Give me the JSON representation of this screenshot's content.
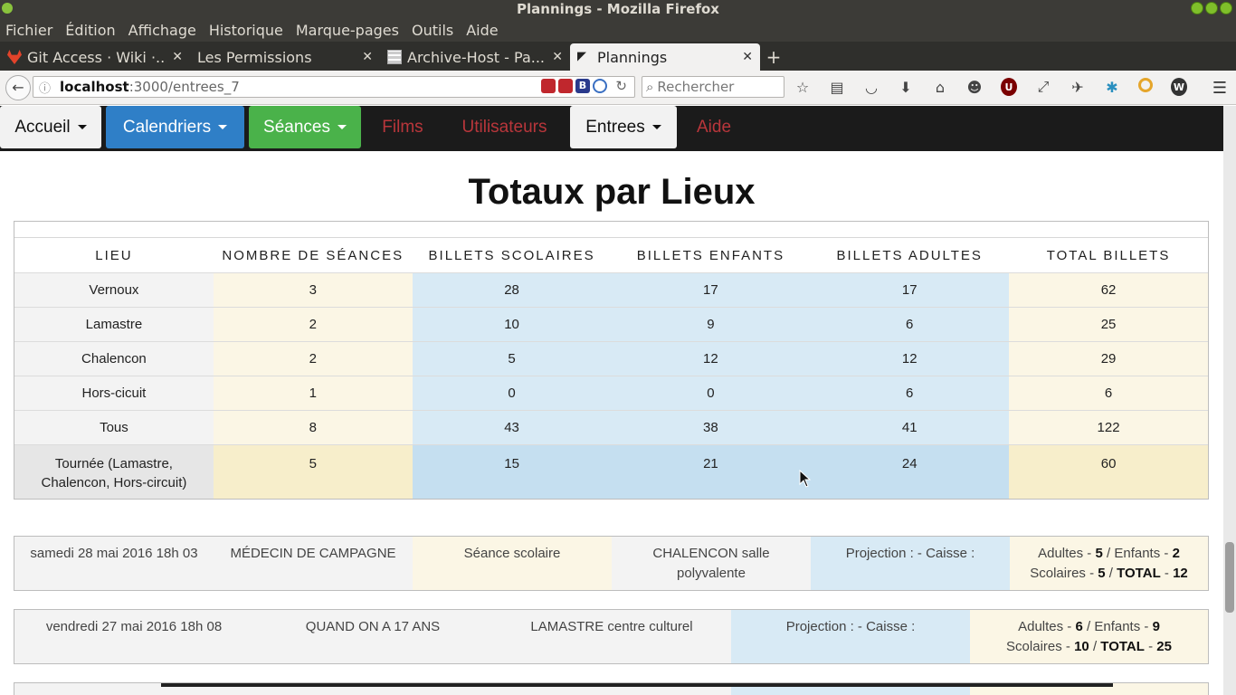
{
  "window": {
    "title": "Plannings - Mozilla Firefox"
  },
  "menubar": [
    "Fichier",
    "Édition",
    "Affichage",
    "Historique",
    "Marque-pages",
    "Outils",
    "Aide"
  ],
  "tabs": [
    {
      "label": "Git Access · Wiki ·...",
      "icon": "gitlab-icon",
      "active": false
    },
    {
      "label": "Les Permissions",
      "icon": "",
      "active": false
    },
    {
      "label": "Archive-Host - Pa...",
      "icon": "grid-icon",
      "active": false
    },
    {
      "label": "Plannings",
      "icon": "page-icon",
      "active": true
    }
  ],
  "urlbar": {
    "host": "localhost",
    "path": ":3000/entrees_7"
  },
  "search": {
    "placeholder": "Rechercher"
  },
  "sitenav": {
    "accueil": "Accueil",
    "calendriers": "Calendriers",
    "seances": "Séances",
    "films": "Films",
    "utilisateurs": "Utilisateurs",
    "entrees": "Entrees",
    "aide": "Aide"
  },
  "colors": {
    "blue": "#2f7fc7",
    "green": "#4ab24a",
    "red_text": "#b9363b",
    "dark_nav": "#1b1b1b"
  },
  "page_title": "Totaux par Lieux",
  "totals": {
    "headers": [
      "LIEU",
      "NOMBRE DE SÉANCES",
      "BILLETS SCOLAIRES",
      "BILLETS ENFANTS",
      "BILLETS ADULTES",
      "TOTAL BILLETS"
    ],
    "rows": [
      [
        "Vernoux",
        "3",
        "28",
        "17",
        "17",
        "62"
      ],
      [
        "Lamastre",
        "2",
        "10",
        "9",
        "6",
        "25"
      ],
      [
        "Chalencon",
        "2",
        "5",
        "12",
        "12",
        "29"
      ],
      [
        "Hors-cicuit",
        "1",
        "0",
        "0",
        "6",
        "6"
      ],
      [
        "Tous",
        "8",
        "43",
        "38",
        "41",
        "122"
      ],
      [
        "Tournée (Lamastre, Chalencon, Hors-circuit)",
        "5",
        "15",
        "21",
        "24",
        "60"
      ]
    ]
  },
  "sessions": [
    {
      "date": "samedi 28 mai 2016 18h 03",
      "film": "MÉDECIN DE CAMPAGNE",
      "type": "Séance scolaire",
      "lieu": "CHALENCON salle polyvalente",
      "projection": "Projection : - Caisse :",
      "adultes_label": "Adultes",
      "adultes": "5",
      "enfants_label": "Enfants",
      "enfants": "2",
      "scolaires_label": "Scolaires",
      "scolaires": "5",
      "total_label": "TOTAL",
      "total": "12"
    },
    {
      "date": "vendredi 27 mai 2016 18h 08",
      "film": "QUAND ON A 17 ANS",
      "lieu": "LAMASTRE centre culturel",
      "projection": "Projection : - Caisse :",
      "adultes_label": "Adultes",
      "adultes": "6",
      "enfants_label": "Enfants",
      "enfants": "9",
      "scolaires_label": "Scolaires",
      "scolaires": "10",
      "total_label": "TOTAL",
      "total": "25"
    }
  ]
}
